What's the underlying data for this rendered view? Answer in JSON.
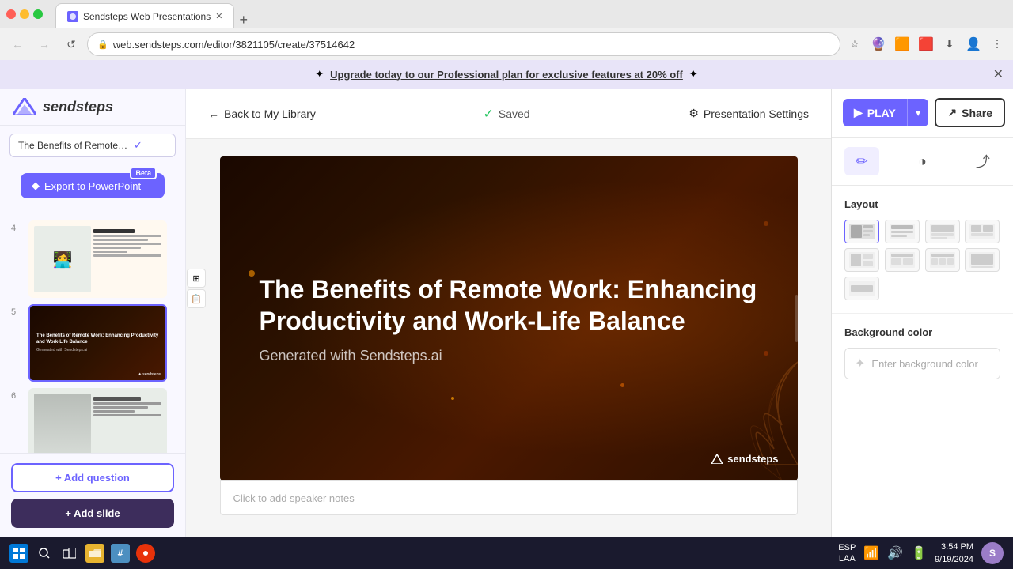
{
  "browser": {
    "tab_title": "Sendsteps Web Presentations",
    "url": "web.sendsteps.com/editor/3821105/create/37514642",
    "new_tab_symbol": "+"
  },
  "promo": {
    "text": "✦ Upgrade today to our Professional plan for exclusive features at 20% off ✦",
    "link_text": "Upgrade today to our Professional plan for exclusive features at 20% off",
    "close_symbol": "✕"
  },
  "header": {
    "logo_text": "sendsteps"
  },
  "nav": {
    "back_label": "Back to My Library",
    "saved_label": "Saved",
    "settings_label": "Presentation Settings"
  },
  "toolbar": {
    "play_label": "PLAY",
    "share_label": "Share"
  },
  "sidebar": {
    "title": "The Benefits of Remote W",
    "export_label": "Export to PowerPoint",
    "beta_label": "Beta",
    "slide_numbers": [
      "4",
      "5",
      "6"
    ],
    "add_question_label": "+ Add question",
    "add_slide_label": "+ Add slide"
  },
  "slide": {
    "title": "The Benefits of Remote Work: Enhancing Productivity and Work-Life Balance",
    "subtitle": "Generated with Sendsteps.ai",
    "logo_text": "sendsteps",
    "speaker_notes_placeholder": "Click to add speaker notes"
  },
  "right_panel": {
    "layout_title": "Layout",
    "bg_color_title": "Background color",
    "bg_color_placeholder": "Enter background color"
  },
  "icons": {
    "pencil": "✏",
    "contrast": "◑",
    "export_arrow": "⤴",
    "gear": "⚙",
    "back_arrow": "←",
    "check": "✓",
    "share": "↗",
    "play": "▶",
    "chevron_down": "▾",
    "star": "✦",
    "diamond": "◆",
    "plus": "+"
  },
  "time": "3:54 PM",
  "date": "9/19/2024",
  "lang": "ESP\nLAA"
}
